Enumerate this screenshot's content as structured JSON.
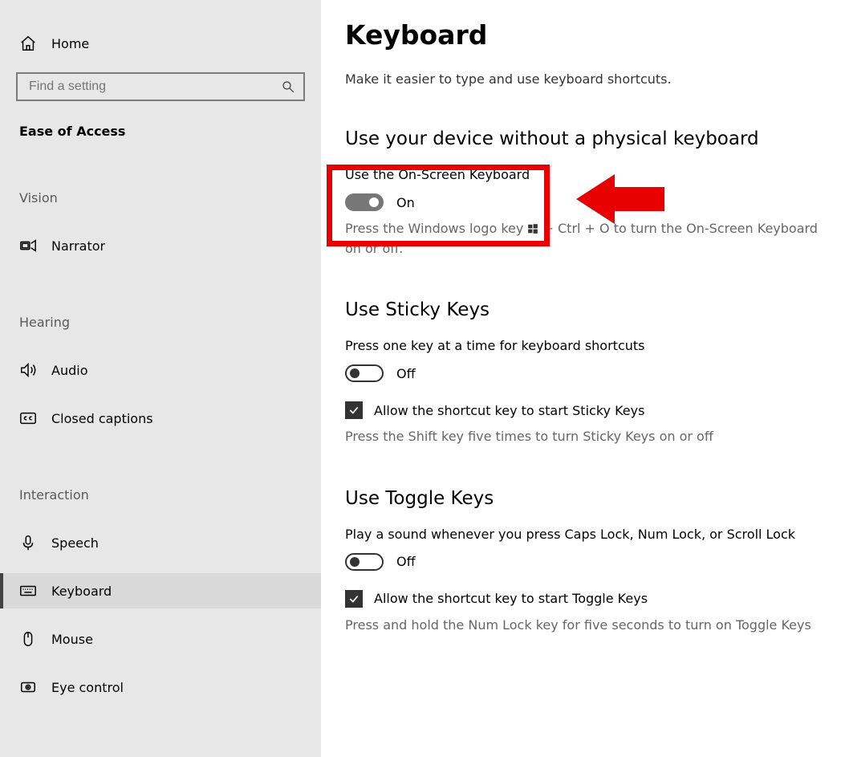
{
  "sidebar": {
    "home": "Home",
    "search_placeholder": "Find a setting",
    "category": "Ease of Access",
    "groups": {
      "vision": {
        "label": "Vision",
        "items": [
          {
            "id": "narrator",
            "label": "Narrator"
          }
        ]
      },
      "hearing": {
        "label": "Hearing",
        "items": [
          {
            "id": "audio",
            "label": "Audio"
          },
          {
            "id": "cc",
            "label": "Closed captions"
          }
        ]
      },
      "interaction": {
        "label": "Interaction",
        "items": [
          {
            "id": "speech",
            "label": "Speech"
          },
          {
            "id": "keyboard",
            "label": "Keyboard"
          },
          {
            "id": "mouse",
            "label": "Mouse"
          },
          {
            "id": "eye",
            "label": "Eye control"
          }
        ]
      }
    },
    "active": "keyboard"
  },
  "main": {
    "title": "Keyboard",
    "desc": "Make it easier to type and use keyboard shortcuts.",
    "osk": {
      "section_title": "Use your device without a physical keyboard",
      "label": "Use the On-Screen Keyboard",
      "state": "On",
      "help_pre": "Press the Windows logo key ",
      "help_post": " + Ctrl + O to turn the On-Screen Keyboard on or off."
    },
    "sticky": {
      "section_title": "Use Sticky Keys",
      "label": "Press one key at a time for keyboard shortcuts",
      "state": "Off",
      "check_label": "Allow the shortcut key to start Sticky Keys",
      "help": "Press the Shift key five times to turn Sticky Keys on or off"
    },
    "toggle": {
      "section_title": "Use Toggle Keys",
      "label": "Play a sound whenever you press Caps Lock, Num Lock, or Scroll Lock",
      "state": "Off",
      "check_label": "Allow the shortcut key to start Toggle Keys",
      "help": "Press and hold the Num Lock key for five seconds to turn on Toggle Keys"
    }
  }
}
